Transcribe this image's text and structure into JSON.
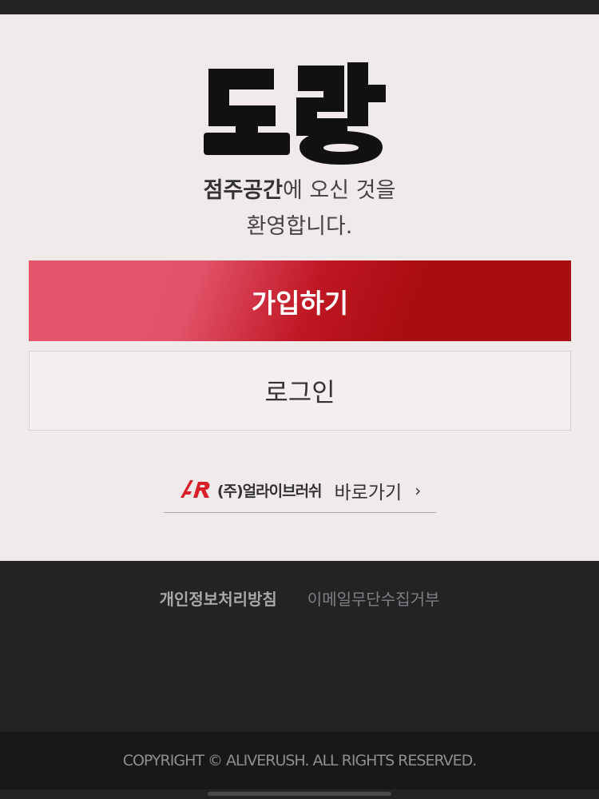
{
  "logo": {
    "text": "도랑",
    "icon": "dorang-logo"
  },
  "welcome": {
    "brand": "점주공간",
    "line1_rest": "에 오신 것을",
    "line2": "환영합니다."
  },
  "buttons": {
    "signup_label": "가입하기",
    "login_label": "로그인"
  },
  "alive_link": {
    "company": "(주)얼라이브러쉬",
    "goto_label": "바로가기",
    "chevron": "›",
    "icon": "aliverush-logo"
  },
  "footer": {
    "privacy_label": "개인정보처리방침",
    "email_label": "이메일무단수집거부",
    "copyright": "COPYRIGHT © ALIVERUSH. ALL RIGHTS RESERVED."
  },
  "colors": {
    "background": "#f1eaea",
    "accent_start": "#e5566d",
    "accent_end": "#a90d11",
    "footer": "#232325"
  }
}
